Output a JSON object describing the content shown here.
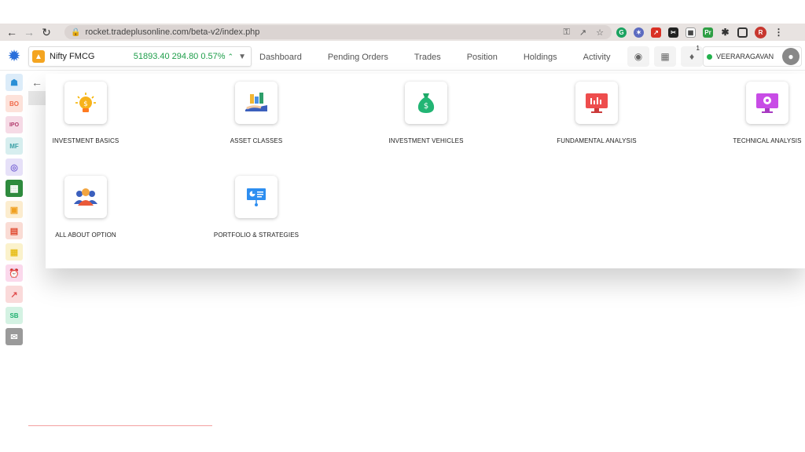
{
  "browser": {
    "url": "rocket.tradeplusonline.com/beta-v2/index.php",
    "profile_initial": "R"
  },
  "ticker": {
    "name": "Nifty FMCG",
    "value": "51893.40 294.80 0.57%",
    "icon": "fmcg-icon"
  },
  "menu": {
    "items": [
      "Dashboard",
      "Pending Orders",
      "Trades",
      "Position",
      "Holdings",
      "Activity"
    ]
  },
  "header": {
    "notification_count": "1",
    "user": "VEERARAGAVAN"
  },
  "sidebar": {
    "items": [
      {
        "label": "",
        "icon": "home-icon",
        "color": "#2a8fd6"
      },
      {
        "label": "BO",
        "icon": "bo-icon",
        "color": "#f06a4a"
      },
      {
        "label": "IPO",
        "icon": "ipo-icon",
        "color": "#b0396b"
      },
      {
        "label": "MF",
        "icon": "mf-icon",
        "color": "#3aa0a6"
      },
      {
        "label": "",
        "icon": "fingerprint-icon",
        "color": "#7d6bd6"
      },
      {
        "label": "",
        "icon": "grid-icon",
        "color": "#2e8b3e"
      },
      {
        "label": "",
        "icon": "bag-icon",
        "color": "#f0a020"
      },
      {
        "label": "",
        "icon": "report-icon",
        "color": "#e04a30"
      },
      {
        "label": "",
        "icon": "calendar-icon",
        "color": "#e8c020"
      },
      {
        "label": "",
        "icon": "alarm-icon",
        "color": "#e040a0"
      },
      {
        "label": "",
        "icon": "chart-icon",
        "color": "#e05050"
      },
      {
        "label": "SB",
        "icon": "sb-icon",
        "color": "#20b070"
      },
      {
        "label": "",
        "icon": "chat-icon",
        "color": "#777777"
      }
    ]
  },
  "tiles": [
    {
      "label": "INVESTMENT BASICS",
      "icon": "lightbulb-icon"
    },
    {
      "label": "ASSET CLASSES",
      "icon": "asset-hand-icon"
    },
    {
      "label": "INVESTMENT VEHICLES",
      "icon": "money-bag-icon"
    },
    {
      "label": "FUNDAMENTAL ANALYSIS",
      "icon": "monitor-chart-icon"
    },
    {
      "label": "TECHNICAL ANALYSIS",
      "icon": "monitor-gear-icon"
    },
    {
      "label": "ALL ABOUT OPTION",
      "icon": "people-icon"
    },
    {
      "label": "PORTFOLIO & STRATEGIES",
      "icon": "presentation-icon"
    }
  ]
}
